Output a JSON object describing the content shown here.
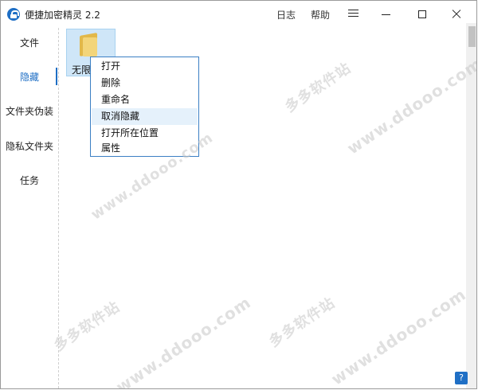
{
  "window": {
    "title": "便捷加密精灵 2.2"
  },
  "titlebar": {
    "log_label": "日志",
    "help_label": "帮助"
  },
  "sidebar": {
    "items": [
      {
        "label": "文件"
      },
      {
        "label": "隐藏"
      },
      {
        "label": "文件夹伪装"
      },
      {
        "label": "隐私文件夹"
      },
      {
        "label": "任务"
      }
    ]
  },
  "files": [
    {
      "name": "无限"
    }
  ],
  "context_menu": {
    "items": [
      {
        "label": "打开"
      },
      {
        "label": "删除"
      },
      {
        "label": "重命名"
      },
      {
        "label": "取消隐藏"
      },
      {
        "label": "打开所在位置"
      },
      {
        "label": "属性"
      }
    ]
  },
  "help_button": {
    "label": "?"
  },
  "watermark": {
    "site_name": "多多软件站",
    "url": "www.ddooo.com"
  },
  "colors": {
    "accent": "#1f6fc5",
    "selection": "#cfe6f8",
    "menu_hover": "#e5f1fb"
  }
}
